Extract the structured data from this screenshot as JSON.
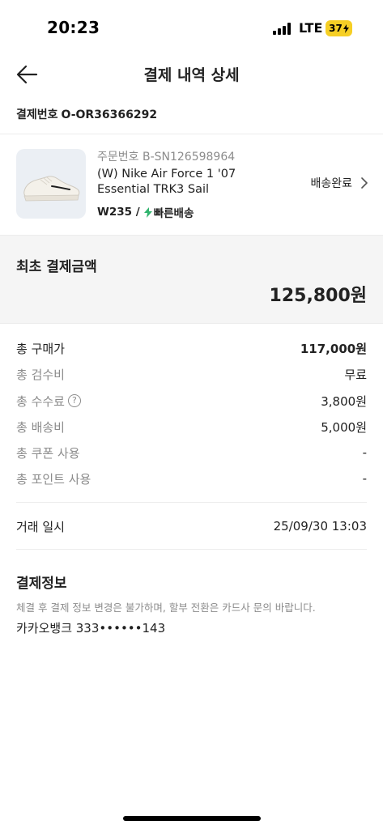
{
  "status_bar": {
    "time": "20:23",
    "network": "LTE",
    "battery": "37"
  },
  "header": {
    "back_icon": "arrow-left-icon",
    "title": "결제 내역 상세"
  },
  "payment": {
    "label": "결제번호",
    "number": "O-OR36366292"
  },
  "product": {
    "order_number": "주문번호 B-SN126598964",
    "name_line1": "(W) Nike Air Force 1 '07",
    "name_line2": "Essential TRK3 Sail",
    "size": "W235 /",
    "shipping_type": "빠른배송",
    "shipping_icon": "lightning-icon",
    "status": "배송완료",
    "status_icon": "chevron-right-icon",
    "accent_color": "#31b46e"
  },
  "total": {
    "label": "최초 결제금액",
    "amount": "125,800원"
  },
  "breakdown": [
    {
      "label": "총 구매가",
      "value": "117,000원"
    },
    {
      "label": "총 검수비",
      "value": "무료"
    },
    {
      "label": "총 수수료",
      "value": "3,800원",
      "icon": "help-circle-icon"
    },
    {
      "label": "총 배송비",
      "value": "5,000원"
    },
    {
      "label": "총 쿠폰 사용",
      "value": "-"
    },
    {
      "label": "총 포인트 사용",
      "value": "-"
    }
  ],
  "transaction": {
    "label": "거래 일시",
    "value": "25/09/30 13:03"
  },
  "payment_info": {
    "title": "결제정보",
    "notice": "체결 후 결제 정보 변경은 불가하며, 할부 전환은 카드사 문의 바랍니다.",
    "card": "카카오뱅크 333••••••143"
  }
}
